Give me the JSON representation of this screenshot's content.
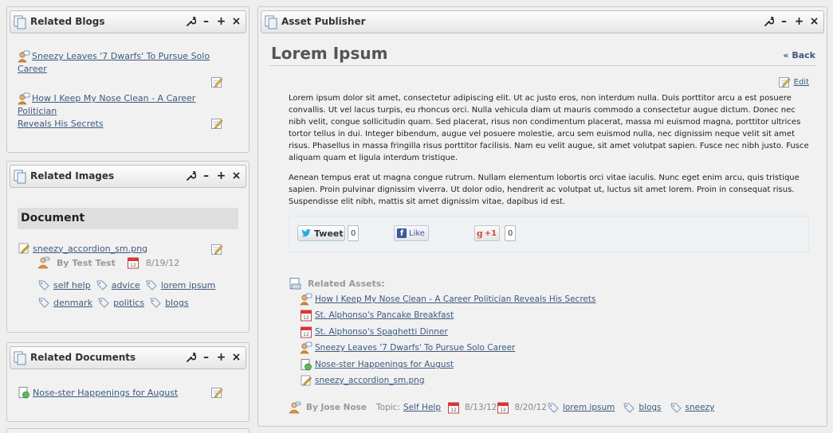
{
  "related_blogs": {
    "title": "Related Blogs",
    "items": [
      {
        "label_line1": "Sneezy Leaves '7 Dwarfs' To Pursue Solo",
        "label_line2": "Career"
      },
      {
        "label_line1": "How I Keep My Nose Clean - A Career Politician",
        "label_line2": "Reveals His Secrets"
      }
    ]
  },
  "related_images": {
    "title": "Related Images",
    "section": "Document",
    "file": "sneezy_accordion_sm.png",
    "author": "By Test Test",
    "date": "8/19/12",
    "tags": [
      "self help",
      "advice",
      "lorem ipsum",
      "denmark",
      "politics",
      "blogs"
    ]
  },
  "related_documents": {
    "title": "Related Documents",
    "items": [
      "Nose-ster Happenings for August"
    ]
  },
  "asset_publisher": {
    "portlet_title": "Asset Publisher",
    "heading": "Lorem Ipsum",
    "back": "« Back",
    "edit": "Edit",
    "paragraph1": "Lorem ipsum dolor sit amet, consectetur adipiscing elit. Ut ac justo eros, non interdum nulla. Duis porttitor arcu a est posuere convallis. Ut vel lacus turpis, eu rhoncus orci. Nulla vehicula diam ut mauris commodo a consectetur augue dictum. Donec nec nibh velit, congue sollicitudin quam. Sed placerat, risus non condimentum placerat, massa mi euismod magna, porttitor ultrices tortor tellus in dui. Integer bibendum, augue vel posuere molestie, arcu sem euismod nulla, nec dignissim neque velit sit amet risus. Phasellus in massa fringilla risus porttitor facilisis. Nam eu velit augue, sit amet volutpat sapien. Fusce nec nibh justo. Fusce aliquam quam et ligula interdum tristique.",
    "paragraph2": "Aenean tempus erat ut magna congue rutrum. Nullam elementum lobortis orci vitae iaculis. Nunc eget enim arcu, quis tristique sapien. Proin pulvinar dignissim viverra. Ut dolor odio, hendrerit ac volutpat ut, luctus sit amet lorem. Proin in consequat risus. Suspendisse elit nibh, mattis sit amet dignissim vitae, dapibus id est.",
    "social": {
      "tweet_label": "Tweet",
      "tweet_count": "0",
      "like_label": "Like",
      "gplus_label": "+1",
      "gplus_count": "0"
    },
    "related_assets_label": "Related Assets:",
    "related_assets": [
      {
        "label": "How I Keep My Nose Clean - A Career Politician Reveals His Secrets",
        "icon": "blog-icon"
      },
      {
        "label": "St. Alphonso's Pancake Breakfast",
        "icon": "calendar-icon"
      },
      {
        "label": "St. Alphonso's Spaghetti Dinner",
        "icon": "calendar-icon"
      },
      {
        "label": "Sneezy Leaves '7 Dwarfs' To Pursue Solo Career",
        "icon": "blog-icon"
      },
      {
        "label": "Nose-ster Happenings for August",
        "icon": "document-icon"
      },
      {
        "label": "sneezy_accordion_sm.png",
        "icon": "image-icon"
      }
    ],
    "meta": {
      "author": "By Jose Nose",
      "topic_label": "Topic:",
      "topic": "Self Help",
      "date1": "8/13/12",
      "date2": "8/20/12",
      "tags": [
        "lorem ipsum",
        "blogs",
        "sneezy"
      ]
    }
  }
}
